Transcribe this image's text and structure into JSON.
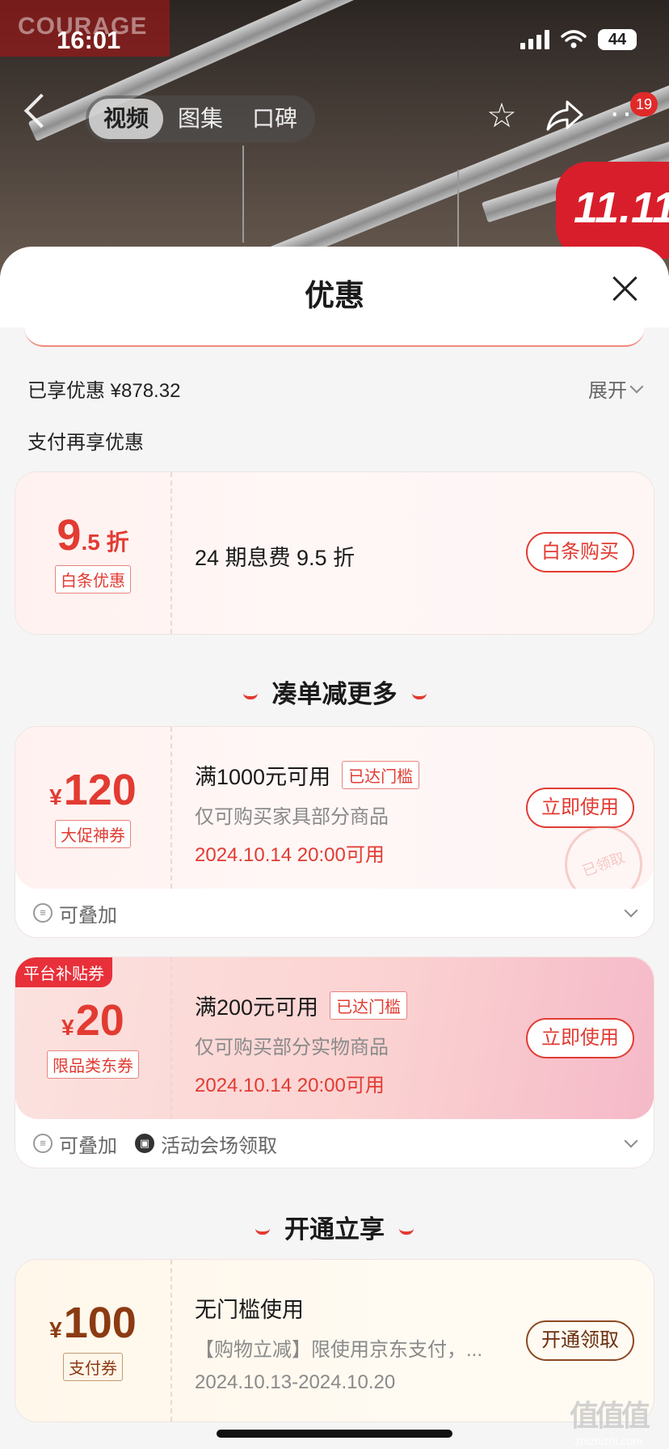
{
  "status_bar": {
    "time": "16:01",
    "battery": "44"
  },
  "hero": {
    "brand_watermark": "COURAGE",
    "sale_badge": "11.11"
  },
  "nav": {
    "tabs": [
      {
        "label": "视频",
        "active": true
      },
      {
        "label": "图集",
        "active": false
      },
      {
        "label": "口碑",
        "active": false
      }
    ],
    "more_badge": "19"
  },
  "sheet": {
    "title": "优惠",
    "enjoyed_label": "已享优惠 ¥878.32",
    "expand_label": "展开",
    "pay_more_label": "支付再享优惠"
  },
  "coupons": [
    {
      "amount_num": "9",
      "amount_dec": ".5 折",
      "currency": "",
      "tag": "白条优惠",
      "title": "24 期息费 9.5 折",
      "button": "白条购买"
    }
  ],
  "sections": {
    "more": "凑单减更多",
    "open": "开通立享"
  },
  "more_coupons": [
    {
      "currency": "¥",
      "amount": "120",
      "tag": "大促神券",
      "title": "满1000元可用",
      "reached": "已达门槛",
      "scope": "仅可购买家具部分商品",
      "valid": "2024.10.14 20:00可用",
      "button": "立即使用",
      "stamp": "已领取",
      "foot": [
        "可叠加"
      ]
    },
    {
      "badge": "平台补贴券",
      "currency": "¥",
      "amount": "20",
      "tag": "限品类东券",
      "title": "满200元可用",
      "reached": "已达门槛",
      "scope": "仅可购买部分实物商品",
      "valid": "2024.10.14 20:00可用",
      "button": "立即使用",
      "foot": [
        "可叠加",
        "活动会场领取"
      ]
    }
  ],
  "open_coupon": {
    "currency": "¥",
    "amount": "100",
    "tag": "支付券",
    "title": "无门槛使用",
    "scope": "【购物立减】限使用京东支付，...",
    "valid": "2024.10.13-2024.10.20",
    "button": "开通领取"
  },
  "watermark": {
    "logo": "值值值",
    "site": "zhizhizhi.com"
  },
  "colors": {
    "accent_red": "#e23b32",
    "gold_brown": "#8b3a12"
  }
}
